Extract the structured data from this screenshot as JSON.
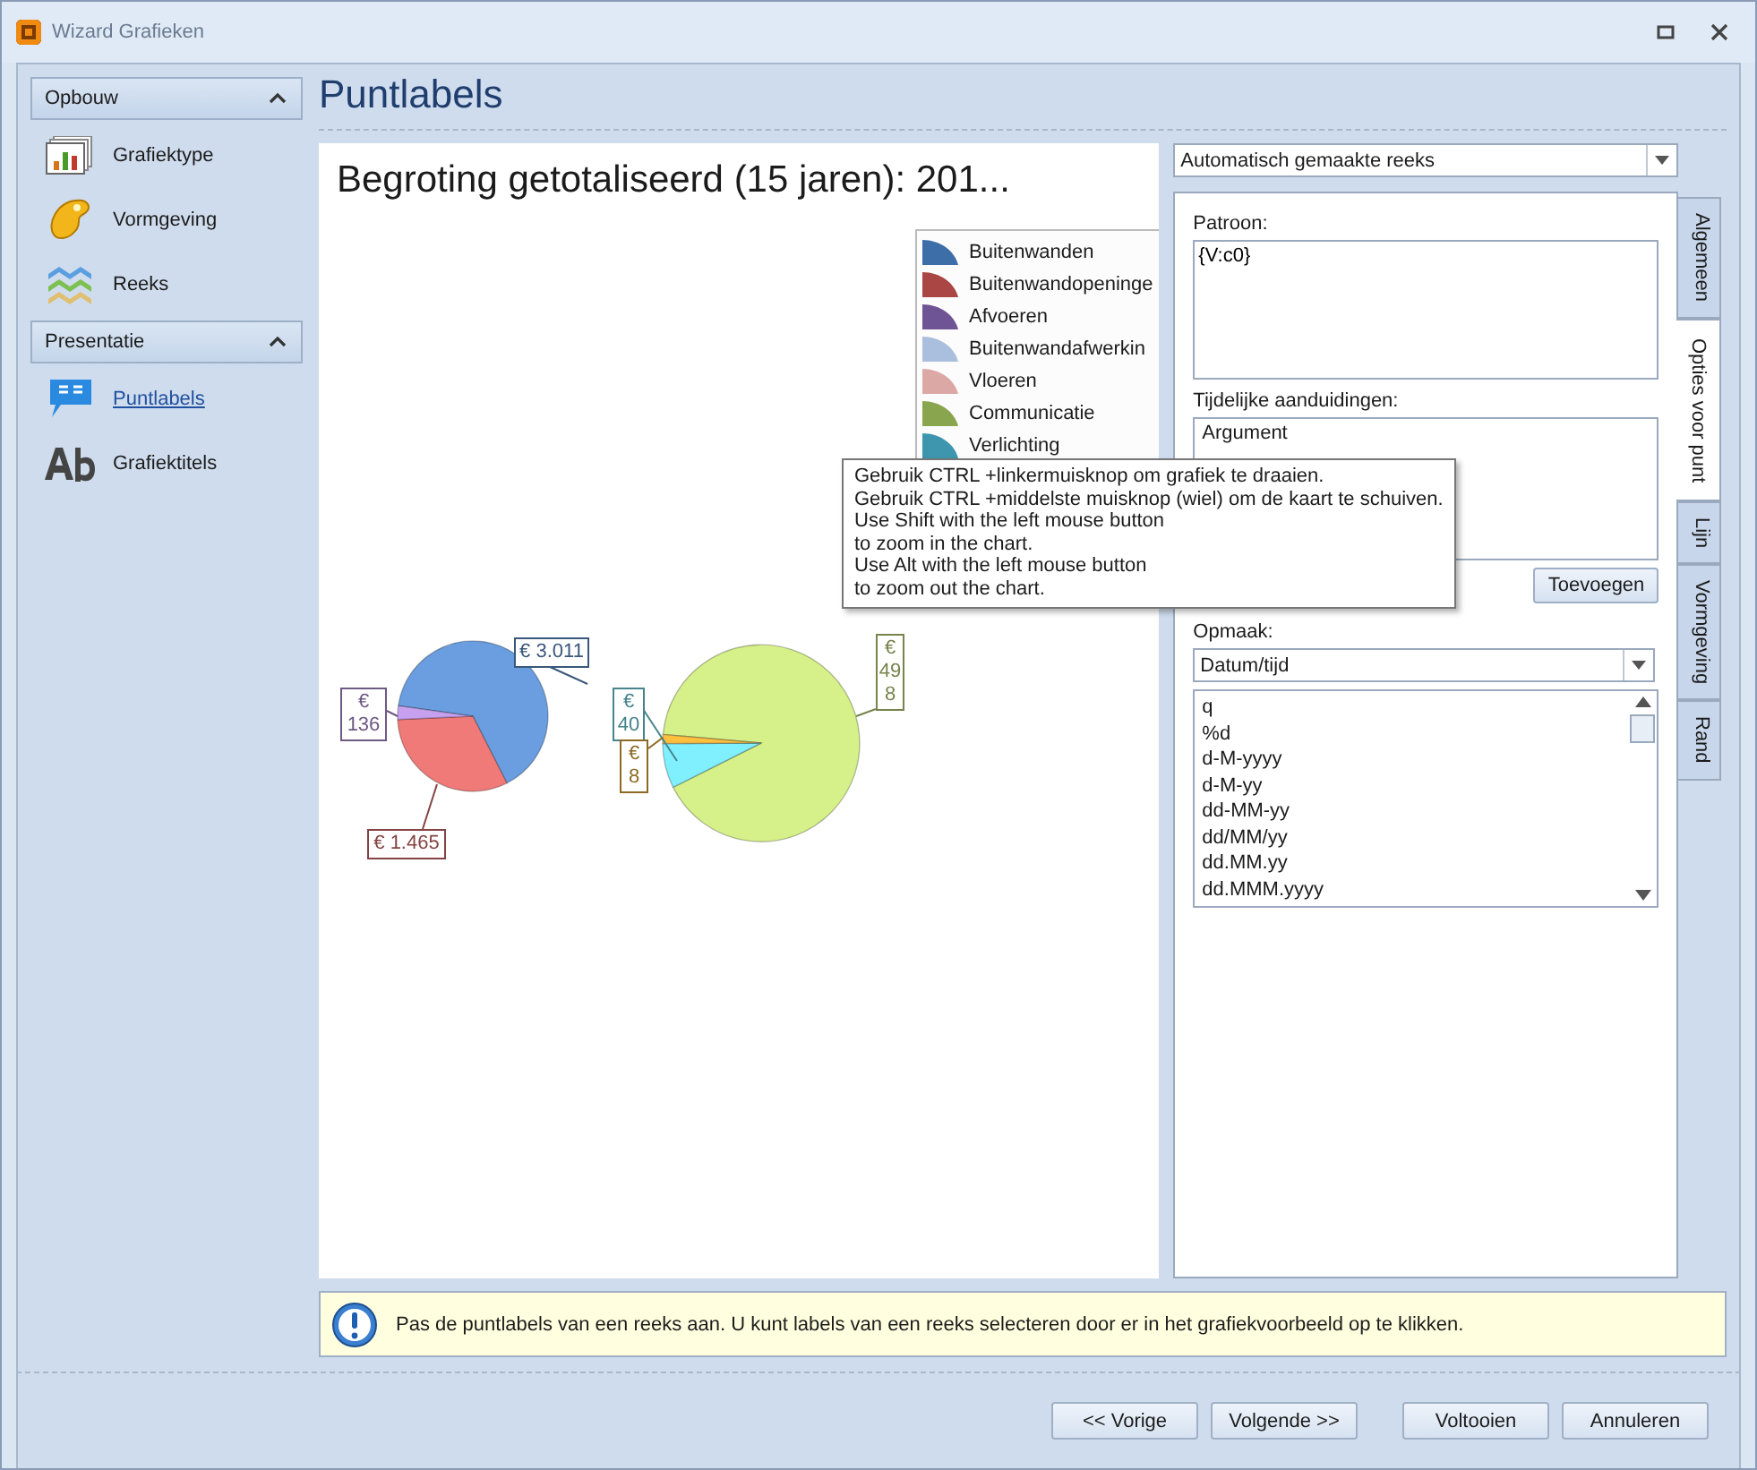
{
  "window": {
    "title": "Wizard Grafieken"
  },
  "sidebar": {
    "groups": [
      {
        "title": "Opbouw",
        "expanded": true,
        "items": [
          {
            "label": "Grafiektype",
            "kind": "chart",
            "selected": false
          },
          {
            "label": "Vormgeving",
            "kind": "palette",
            "selected": false
          },
          {
            "label": "Reeks",
            "kind": "layers",
            "selected": false
          }
        ]
      },
      {
        "title": "Presentatie",
        "expanded": true,
        "items": [
          {
            "label": "Puntlabels",
            "kind": "percent",
            "selected": true
          },
          {
            "label": "Grafiektitels",
            "kind": "text",
            "selected": false
          }
        ]
      }
    ]
  },
  "page_title": "Puntlabels",
  "chart": {
    "chart_data": {
      "type": "pie",
      "title": "Begroting getotaliseerd (15 jaren): 201...",
      "series": [
        {
          "values": [
            3011,
            1465,
            136
          ],
          "value_labels": [
            "€ 3.011",
            "€ 1.465",
            "€ 136"
          ],
          "colors": [
            "#6a9ee0",
            "#f07a78",
            "#c8a0f0"
          ]
        },
        {
          "values": [
            498,
            40,
            8
          ],
          "value_labels": [
            "€ 498",
            "€ 40",
            "€ 8"
          ],
          "colors": [
            "#d6f08a",
            "#80f0ff",
            "#ffc040"
          ]
        }
      ]
    },
    "legend": {
      "items": [
        {
          "label": "Buitenwanden",
          "color": "#3e6ea8"
        },
        {
          "label": "Buitenwandopeninge",
          "color": "#aa4643"
        },
        {
          "label": "Afvoeren",
          "color": "#6e5494"
        },
        {
          "label": "Buitenwandafwerkin",
          "color": "#a9bfdd"
        },
        {
          "label": "Vloeren",
          "color": "#dca8a6"
        },
        {
          "label": "Communicatie",
          "color": "#89a54e"
        },
        {
          "label": "Verlichting",
          "color": "#3d96ae"
        }
      ]
    }
  },
  "tooltip": {
    "lines": [
      "Gebruik CTRL +linkermuisknop om grafiek te draaien.",
      "Gebruik CTRL +middelste muisknop (wiel) om de kaart te schuiven.",
      "Use Shift with the left mouse button",
      "to zoom in the chart.",
      "Use Alt with the left mouse button",
      "to zoom out the chart."
    ]
  },
  "series_select": {
    "value": "Automatisch gemaakte reeks"
  },
  "tabs": [
    {
      "label": "Algemeen",
      "selected": false
    },
    {
      "label": "Opties voor punt",
      "selected": true
    },
    {
      "label": "Lijn",
      "selected": false
    },
    {
      "label": "Vormgeving",
      "selected": false
    },
    {
      "label": "Rand",
      "selected": false
    }
  ],
  "pattern": {
    "label": "Patroon:",
    "value": "{V:c0}"
  },
  "placeholders": {
    "label": "Tijdelijke aanduidingen:",
    "items": [
      "Argument"
    ]
  },
  "add_button": "Toevoegen",
  "format": {
    "label": "Opmaak:",
    "value": "Datum/tijd",
    "items": [
      "q",
      "%d",
      "d-M-yyyy",
      "d-M-yy",
      "dd-MM-yy",
      "dd/MM/yy",
      "dd.MM.yy",
      "dd.MMM.yyyy"
    ]
  },
  "info": "Pas de puntlabels van een reeks aan. U kunt labels van een reeks selecteren door er in het grafiekvoorbeeld op te klikken.",
  "buttons": [
    "<< Vorige",
    "Volgende >>",
    "Voltooien",
    "Annuleren"
  ]
}
